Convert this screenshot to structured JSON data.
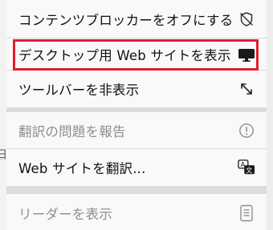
{
  "background": {
    "edge_text": "日"
  },
  "menu": {
    "group1": [
      {
        "label": "コンテンツブロッカーをオフにする",
        "icon": "shield-slash-icon",
        "disabled": false
      },
      {
        "label": "デスクトップ用 Web サイトを表示",
        "icon": "desktop-monitor-icon",
        "disabled": false
      },
      {
        "label": "ツールバーを非表示",
        "icon": "expand-arrows-icon",
        "disabled": false
      }
    ],
    "group2": [
      {
        "label": "翻訳の問題を報告",
        "icon": "exclamation-circle-icon",
        "disabled": true
      },
      {
        "label": "Web サイトを翻訳...",
        "icon": "translate-icon",
        "disabled": false
      }
    ],
    "group3": [
      {
        "label": "リーダーを表示",
        "icon": "reader-document-icon",
        "disabled": true
      }
    ]
  },
  "colors": {
    "highlight": "#e01e2e",
    "menu_bg": "#f9f9f9",
    "disabled_text": "#8e8e8e"
  }
}
